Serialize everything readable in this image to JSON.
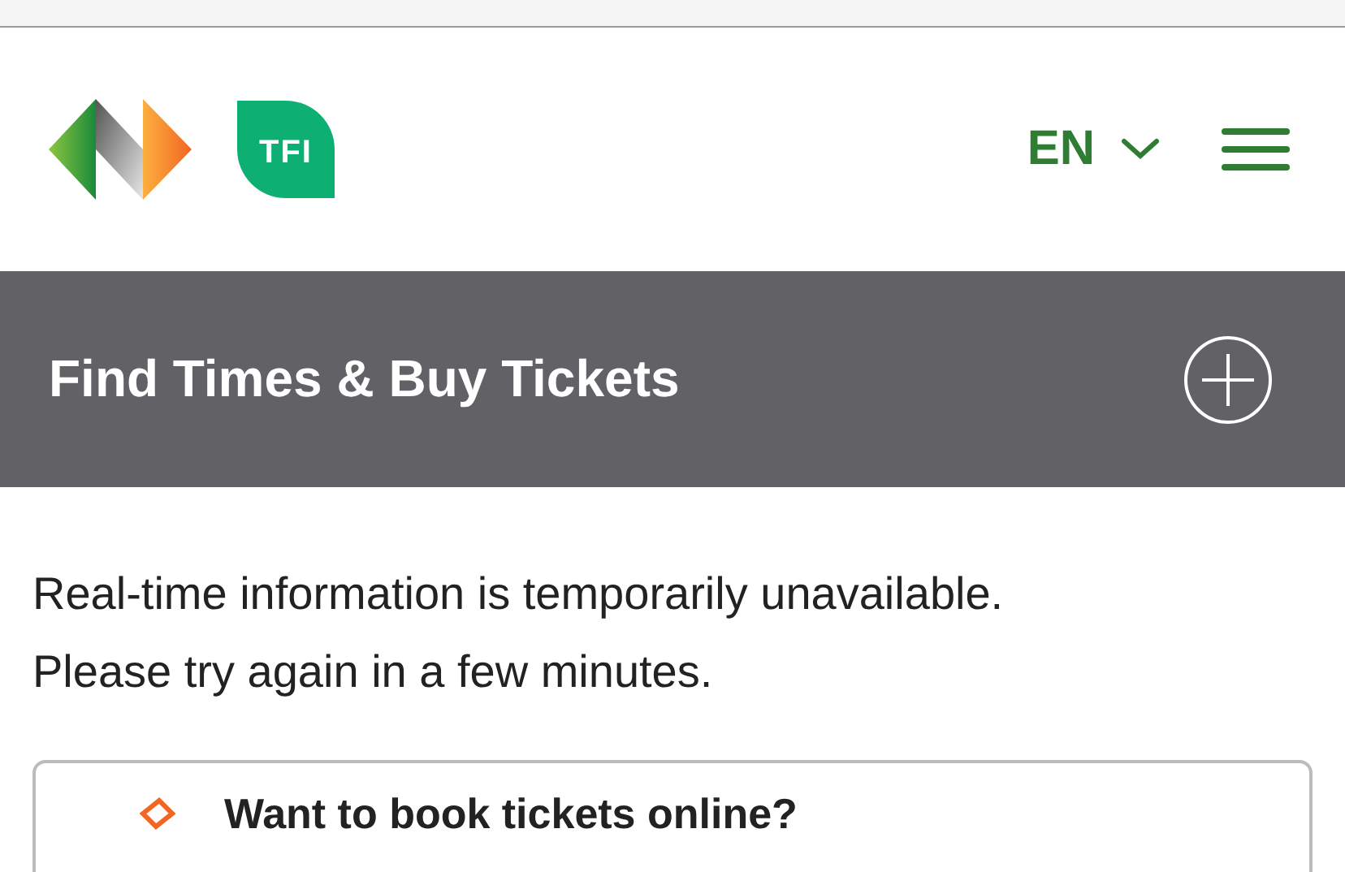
{
  "header": {
    "logo_text": "TFI",
    "language": "EN"
  },
  "banner": {
    "title": "Find Times & Buy Tickets",
    "expanded": false
  },
  "notice": [
    "Real-time information is temporarily unavailable.",
    "Please try again in a few minutes."
  ],
  "card": {
    "title": "Want to book tickets online?"
  }
}
